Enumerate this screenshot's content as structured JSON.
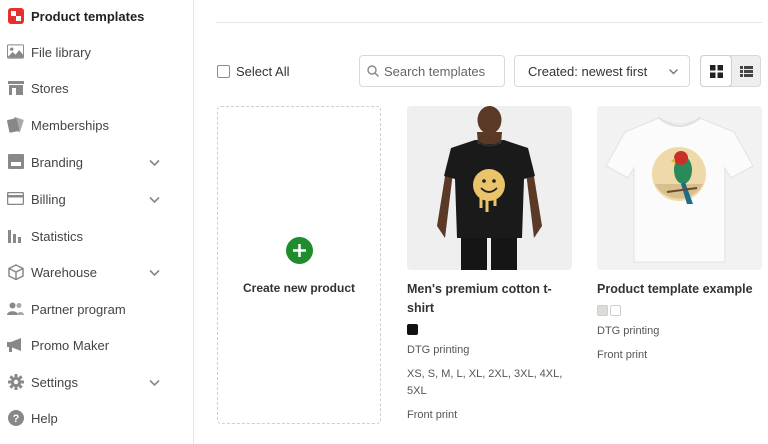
{
  "sidebar": {
    "items": [
      {
        "label": "Product templates",
        "icon": "product-templates-icon",
        "active": true
      },
      {
        "label": "File library",
        "icon": "image-icon"
      },
      {
        "label": "Stores",
        "icon": "store-icon"
      },
      {
        "label": "Memberships",
        "icon": "membership-icon"
      },
      {
        "label": "Branding",
        "icon": "branding-icon",
        "expandable": true
      },
      {
        "label": "Billing",
        "icon": "credit-card-icon",
        "expandable": true
      },
      {
        "label": "Statistics",
        "icon": "bar-chart-icon"
      },
      {
        "label": "Warehouse",
        "icon": "box-icon",
        "expandable": true
      },
      {
        "label": "Partner program",
        "icon": "people-icon"
      },
      {
        "label": "Promo Maker",
        "icon": "megaphone-icon"
      },
      {
        "label": "Settings",
        "icon": "gear-icon",
        "expandable": true
      },
      {
        "label": "Help",
        "icon": "help-icon"
      }
    ]
  },
  "toolbar": {
    "select_all_label": "Select All",
    "search_placeholder": "Search templates",
    "sort_value": "Created: newest first"
  },
  "create_card": {
    "label": "Create new product"
  },
  "products": [
    {
      "title": "Men's premium cotton t-shirt",
      "colors": [
        "#111111"
      ],
      "printing": "DTG printing",
      "sizes": "XS, S, M, L, XL, 2XL, 3XL, 4XL, 5XL",
      "placement": "Front print"
    },
    {
      "title": "Product template example",
      "colors": [
        "#dcdcd8",
        "#ffffff"
      ],
      "printing": "DTG printing",
      "placement": "Front print"
    }
  ],
  "colors": {
    "brand_red": "#e4312b",
    "create_green": "#1f8c2e"
  }
}
